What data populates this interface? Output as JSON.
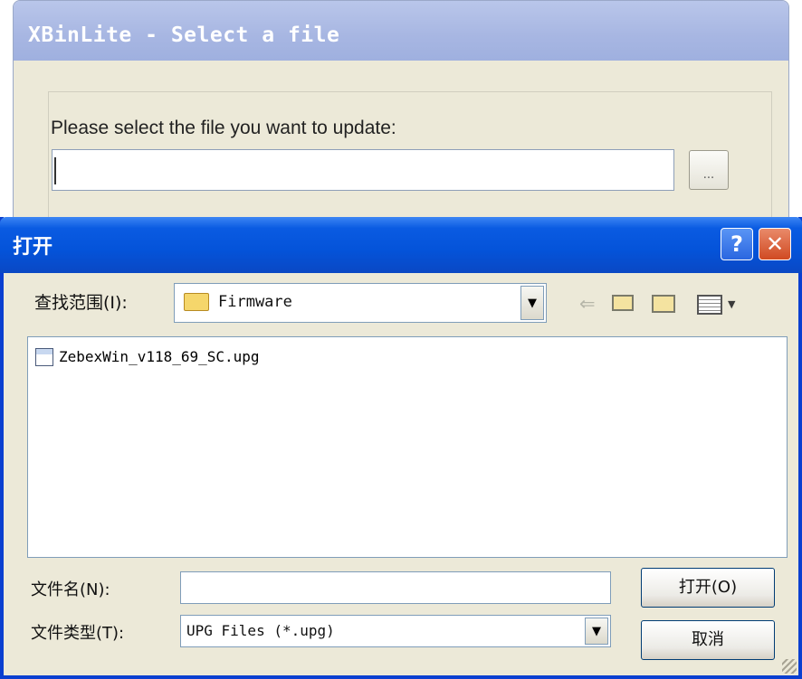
{
  "back_window": {
    "title": "XBinLite - Select a file",
    "prompt": "Please select the file you want to update:",
    "file_path_value": "",
    "browse_label": "..."
  },
  "open_dialog": {
    "title": "打开",
    "help_label": "?",
    "close_label": "✕",
    "look_in_label": "查找范围(I):",
    "look_in_value": "Firmware",
    "files": [
      {
        "name": "ZebexWin_v118_69_SC.upg",
        "icon": "upg-file-icon"
      }
    ],
    "filename_label": "文件名(N):",
    "filename_value": "",
    "filetype_label": "文件类型(T):",
    "filetype_value": "UPG Files (*.upg)",
    "open_button": "打开(O)",
    "cancel_button": "取消",
    "toolbar_icons": [
      "back-arrow-icon",
      "up-folder-icon",
      "new-folder-icon",
      "view-menu-icon"
    ]
  },
  "colors": {
    "dialog_titlebar": "#0453d9",
    "window_background": "#ece9d8",
    "back_titlebar": "#a7b6e2"
  }
}
